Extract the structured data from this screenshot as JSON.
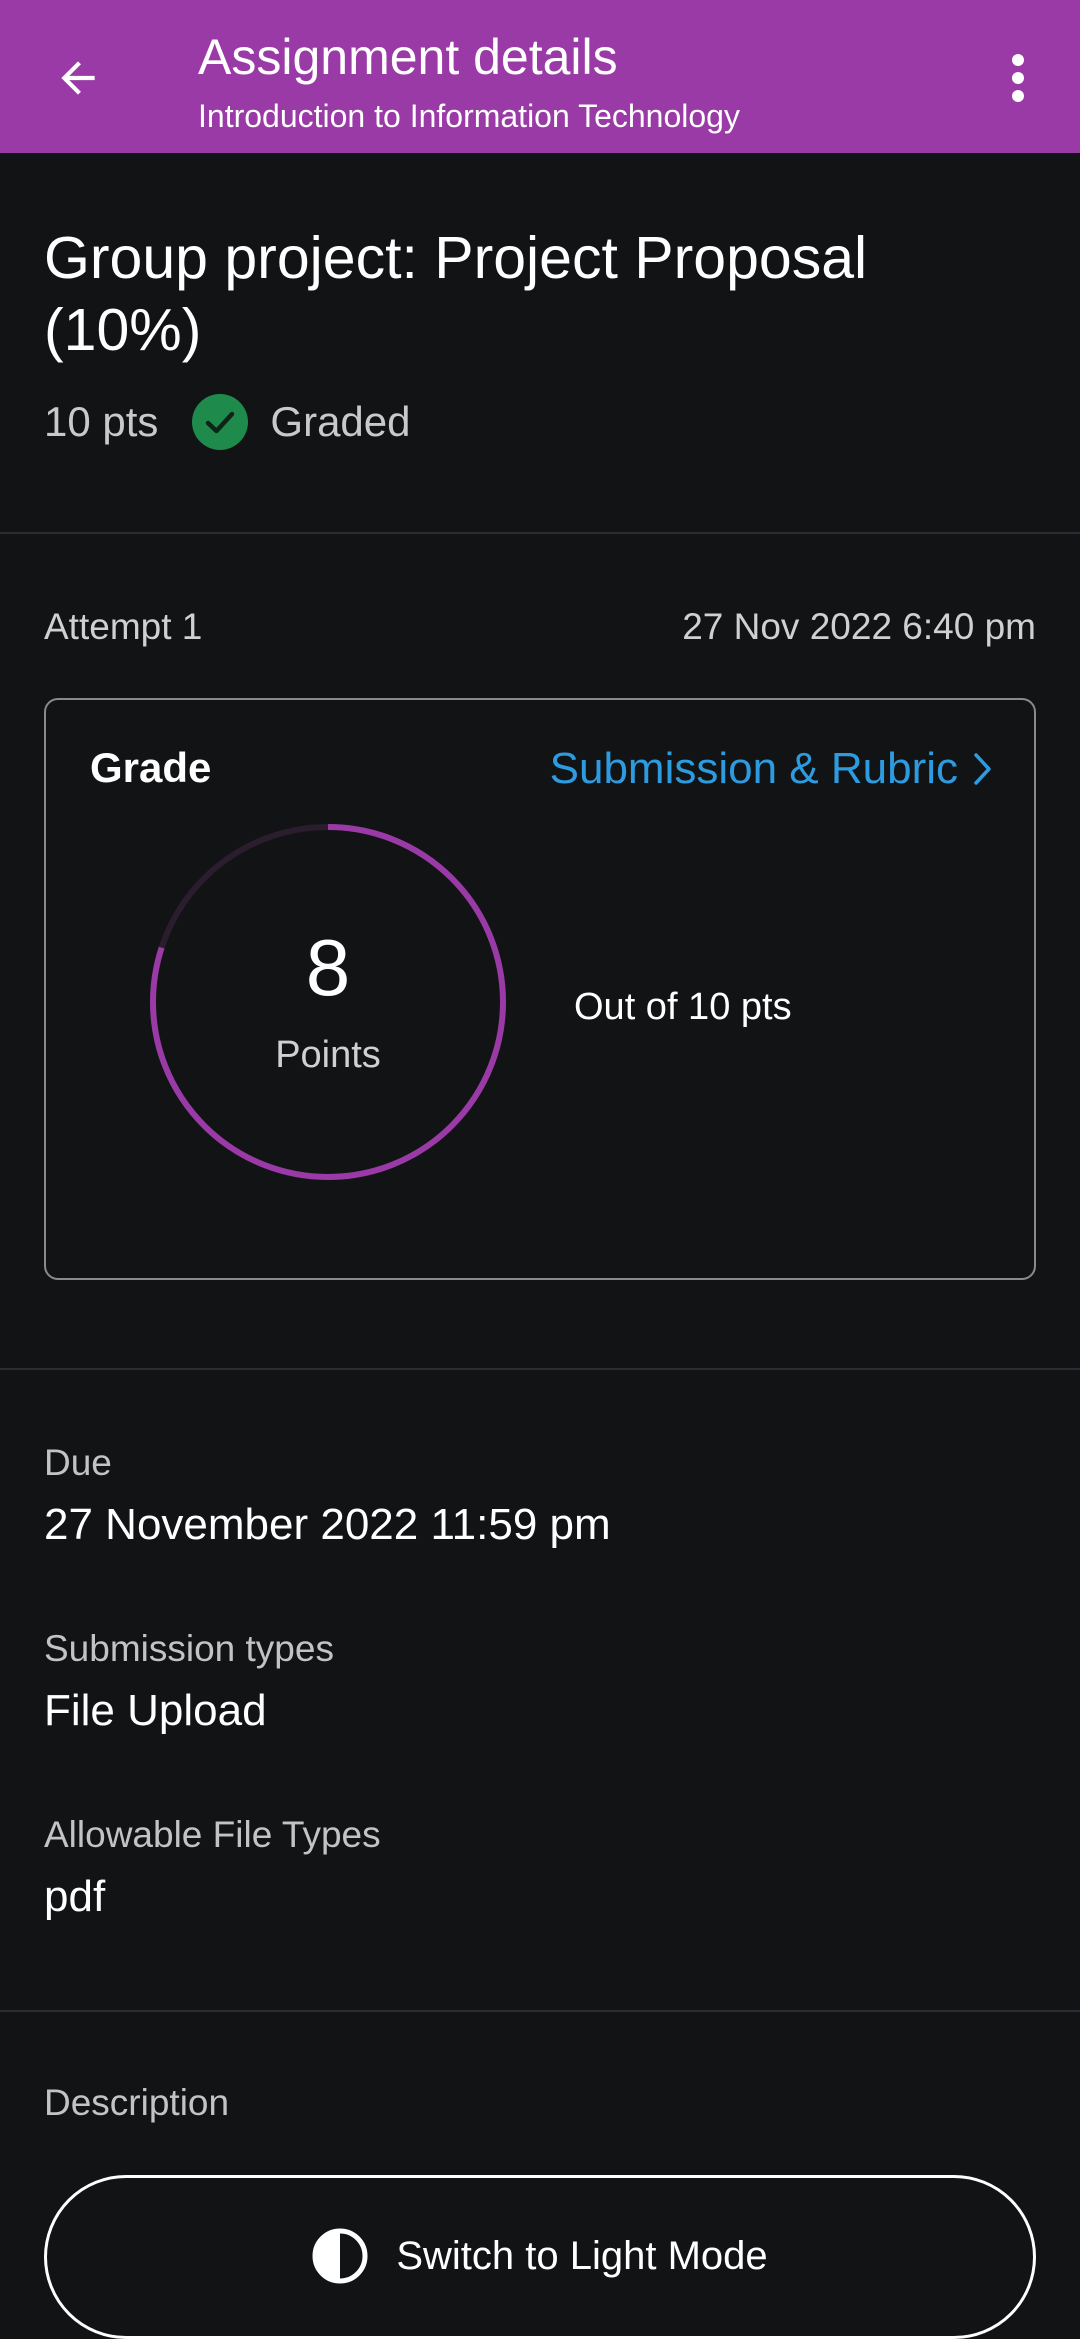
{
  "header": {
    "title": "Assignment details",
    "subtitle": "Introduction to Information Technology",
    "background_color": "#9a3aa6",
    "back_icon": "arrow-left-icon",
    "menu_icon": "more-vertical-icon"
  },
  "assignment": {
    "title": "Group project: Project Proposal (10%)",
    "points": "10 pts",
    "status": "Graded",
    "status_icon": "check-circle-icon",
    "status_color": "#1e8a4c"
  },
  "attempt": {
    "label": "Attempt 1",
    "date": "27 Nov 2022 6:40 pm"
  },
  "grade": {
    "label": "Grade",
    "link_label": "Submission & Rubric",
    "link_color": "#2d9be0",
    "score": "8",
    "score_unit": "Points",
    "out_of": "Out of 10 pts",
    "score_fraction": 0.8,
    "ring_color": "#9a3aa6"
  },
  "details": {
    "due_label": "Due",
    "due_value": "27 November 2022 11:59 pm",
    "submission_types_label": "Submission types",
    "submission_types_value": "File Upload",
    "file_types_label": "Allowable File Types",
    "file_types_value": "pdf",
    "description_label": "Description"
  },
  "theme_button": {
    "label": "Switch to Light Mode",
    "icon": "contrast-icon"
  }
}
